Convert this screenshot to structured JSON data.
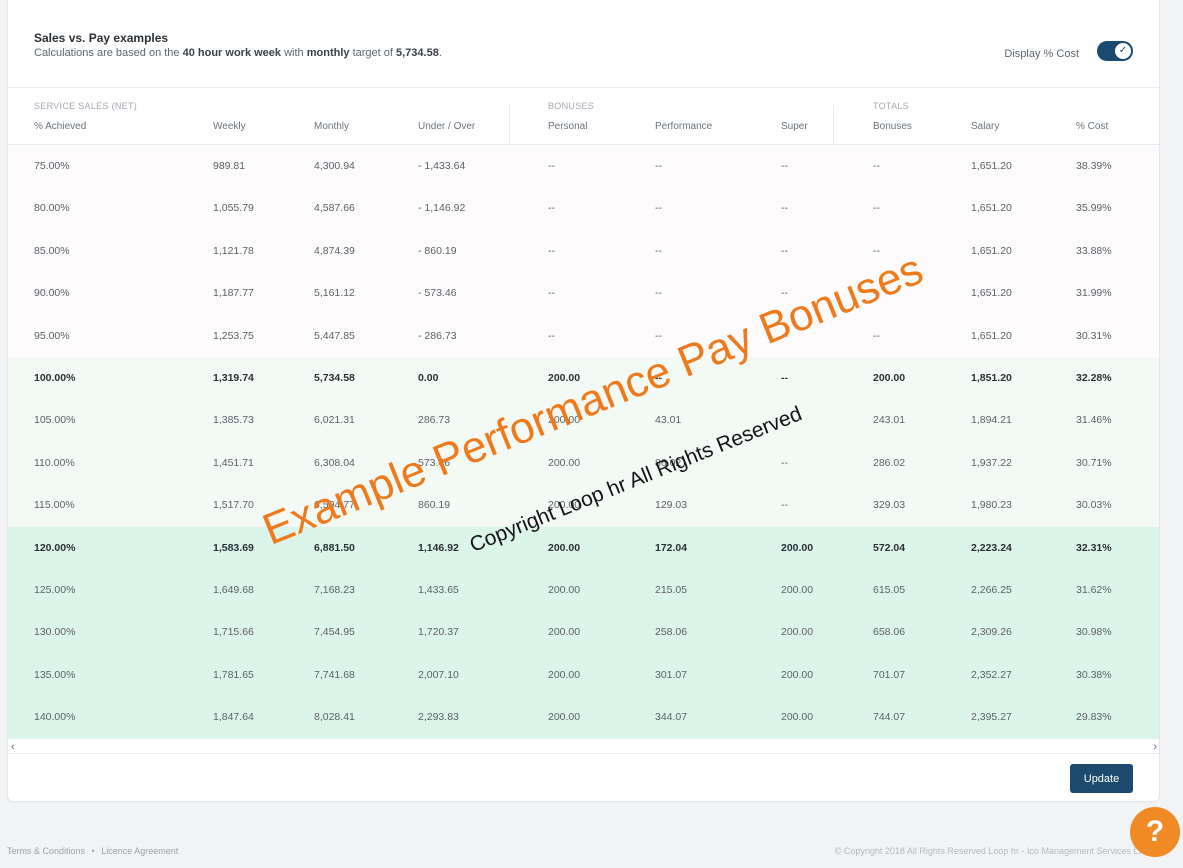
{
  "header": {
    "title": "Sales vs. Pay examples",
    "sub_prefix": "Calculations are based on the ",
    "hours": "40 hour work week",
    "sub_mid": " with ",
    "period": "monthly",
    "sub_mid2": " target of ",
    "target": "5,734.58",
    "sub_end": "."
  },
  "toggle": {
    "label": "Display % Cost",
    "state": "on",
    "icon": "check-icon"
  },
  "table": {
    "groups": [
      "SERVICE SALES (NET)",
      "BONUSES",
      "TOTALS"
    ],
    "columns": [
      "% Achieved",
      "Weekly",
      "Monthly",
      "Under / Over",
      "Personal",
      "Performance",
      "Super",
      "Bonuses",
      "Salary",
      "% Cost"
    ],
    "rows": [
      [
        "75.00%",
        "989.81",
        "4,300.94",
        "- 1,433.64",
        "--",
        "--",
        "--",
        "--",
        "1,651.20",
        "38.39%"
      ],
      [
        "80.00%",
        "1,055.79",
        "4,587.66",
        "- 1,146.92",
        "--",
        "--",
        "--",
        "--",
        "1,651.20",
        "35.99%"
      ],
      [
        "85.00%",
        "1,121.78",
        "4,874.39",
        "- 860.19",
        "--",
        "--",
        "--",
        "--",
        "1,651.20",
        "33.88%"
      ],
      [
        "90.00%",
        "1,187.77",
        "5,161.12",
        "- 573.46",
        "--",
        "--",
        "--",
        "--",
        "1,651.20",
        "31.99%"
      ],
      [
        "95.00%",
        "1,253.75",
        "5,447.85",
        "- 286.73",
        "--",
        "--",
        "--",
        "--",
        "1,651.20",
        "30.31%"
      ],
      [
        "100.00%",
        "1,319.74",
        "5,734.58",
        "0.00",
        "200.00",
        "--",
        "--",
        "200.00",
        "1,851.20",
        "32.28%"
      ],
      [
        "105.00%",
        "1,385.73",
        "6,021.31",
        "286.73",
        "200.00",
        "43.01",
        "--",
        "243.01",
        "1,894.21",
        "31.46%"
      ],
      [
        "110.00%",
        "1,451.71",
        "6,308.04",
        "573.46",
        "200.00",
        "86.02",
        "--",
        "286.02",
        "1,937.22",
        "30.71%"
      ],
      [
        "115.00%",
        "1,517.70",
        "6,594.77",
        "860.19",
        "200.00",
        "129.03",
        "--",
        "329.03",
        "1,980.23",
        "30.03%"
      ],
      [
        "120.00%",
        "1,583.69",
        "6,881.50",
        "1,146.92",
        "200.00",
        "172.04",
        "200.00",
        "572.04",
        "2,223.24",
        "32.31%"
      ],
      [
        "125.00%",
        "1,649.68",
        "7,168.23",
        "1,433.65",
        "200.00",
        "215.05",
        "200.00",
        "615.05",
        "2,266.25",
        "31.62%"
      ],
      [
        "130.00%",
        "1,715.66",
        "7,454.95",
        "1,720.37",
        "200.00",
        "258.06",
        "200.00",
        "658.06",
        "2,309.26",
        "30.98%"
      ],
      [
        "135.00%",
        "1,781.65",
        "7,741.68",
        "2,007.10",
        "200.00",
        "301.07",
        "200.00",
        "701.07",
        "2,352.27",
        "30.38%"
      ],
      [
        "140.00%",
        "1,847.64",
        "8,028.41",
        "2,293.83",
        "200.00",
        "344.07",
        "200.00",
        "744.07",
        "2,395.27",
        "29.83%"
      ]
    ],
    "row_tiers": [
      0,
      0,
      0,
      0,
      0,
      1,
      1,
      1,
      1,
      2,
      2,
      2,
      2,
      2
    ],
    "bold_rows": [
      5,
      9
    ],
    "tier_colors": [
      "#fdfbfb",
      "#f3faf6",
      "#dcf5ea"
    ]
  },
  "scroll": {
    "left": "‹",
    "right": "›"
  },
  "actions": {
    "update_label": "Update"
  },
  "watermark": {
    "main": "Example Performance Pay Bonuses",
    "sub": "Copyright Loop hr All Rights Reserved",
    "color": "#ef7a1c"
  },
  "footer": {
    "terms": "Terms & Conditions",
    "sep": "•",
    "licence": "Licence Agreement",
    "copyright": "© Copyright 2018 All Rights Reserved Loop hr - Ico Management Services Ltd"
  },
  "help": {
    "label": "?",
    "color": "#f08a24"
  },
  "colors": {
    "primary": "#1c4a6e"
  }
}
